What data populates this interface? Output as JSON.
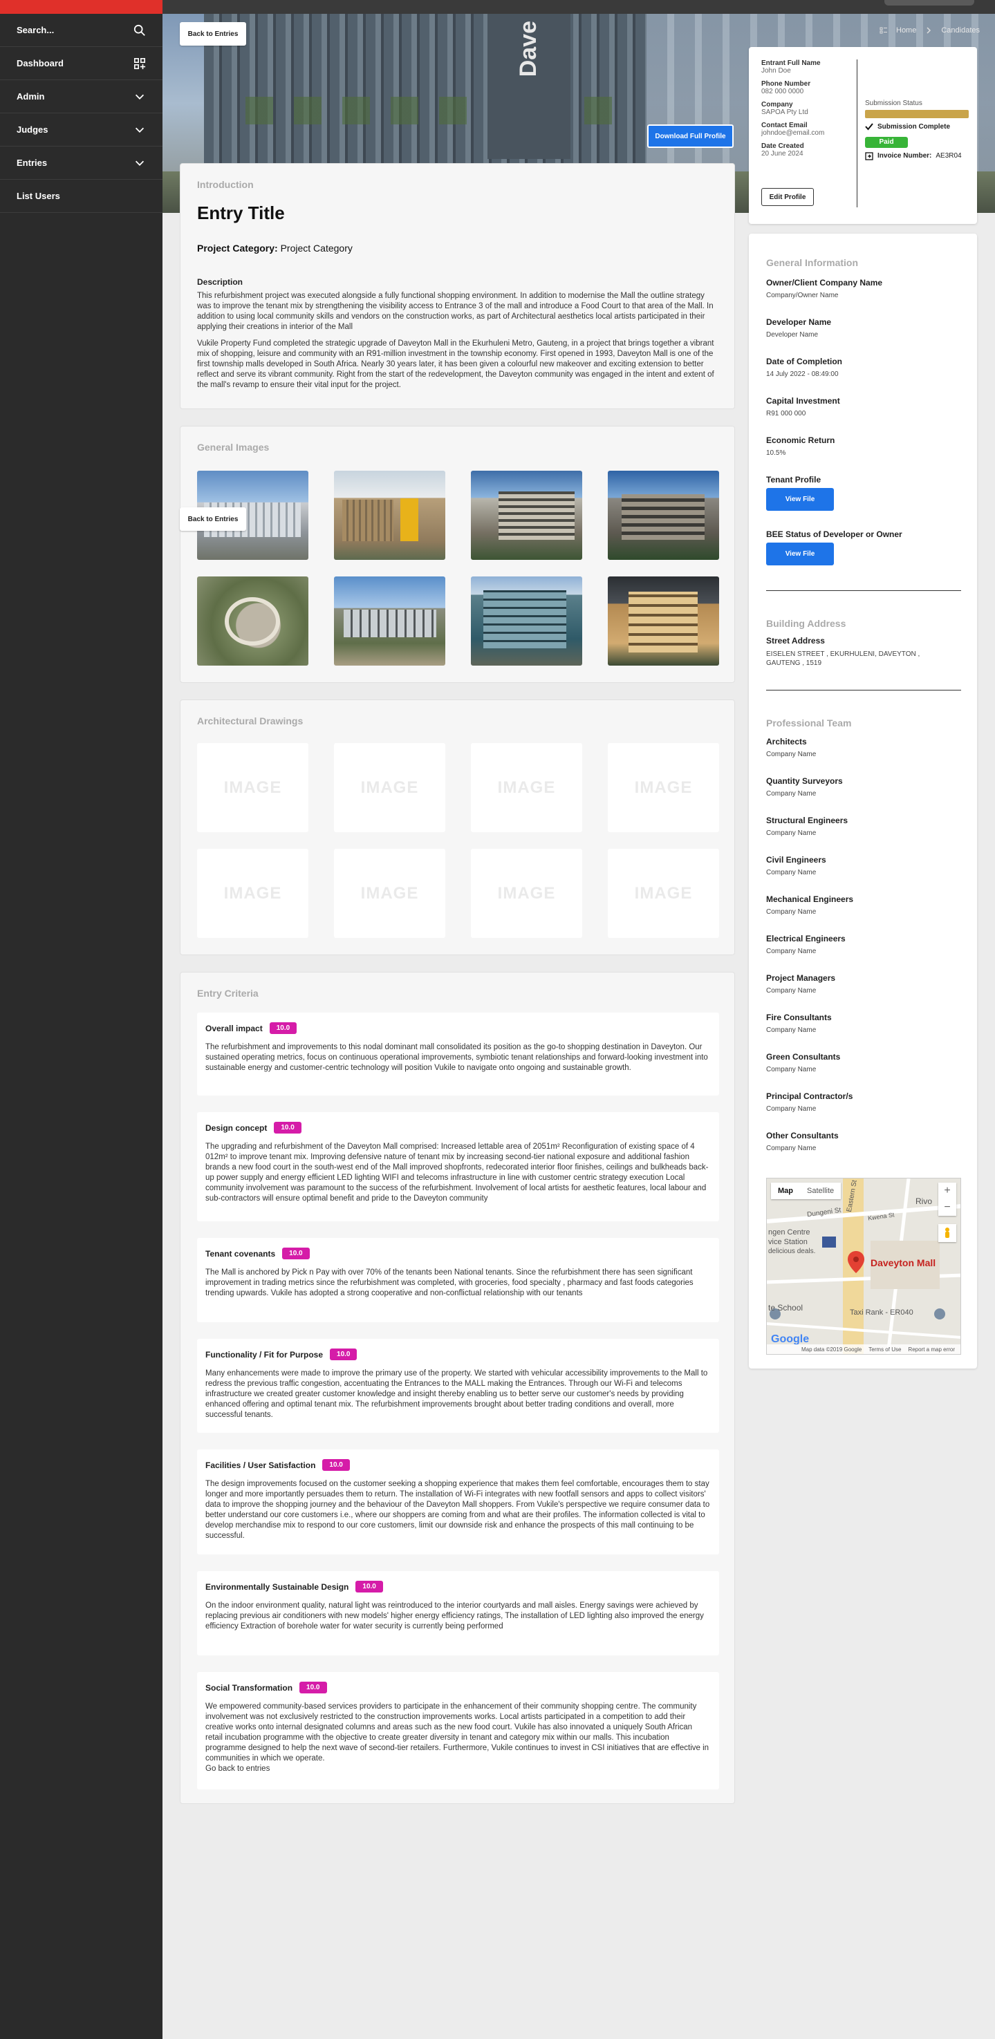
{
  "sidebar": {
    "search_label": "Search...",
    "items": [
      {
        "label": "Dashboard"
      },
      {
        "label": "Admin"
      },
      {
        "label": "Judges"
      },
      {
        "label": "Entries"
      },
      {
        "label": "List Users"
      }
    ]
  },
  "breadcrumb": {
    "home": "Home",
    "current": "Candidates"
  },
  "hero": {
    "sign_text": "Dave"
  },
  "buttons": {
    "back_to_entries": "Back to Entries",
    "download_profile": "Download Full Profile",
    "edit_profile": "Edit Profile",
    "view_file": "View File"
  },
  "profile": {
    "entrant_label": "Entrant Full Name",
    "entrant_value": "John Doe",
    "phone_label": "Phone Number",
    "phone_value": "082 000 0000",
    "company_label": "Company",
    "company_value": "SAPOA Pty Ltd",
    "email_label": "Contact Email",
    "email_value": "johndoe@email.com",
    "date_label": "Date Created",
    "date_value": "20 June 2024",
    "status_label": "Submission Status",
    "status_progress": 1.0,
    "status_complete": "Submission Complete",
    "paid": "Paid",
    "invoice_label": "Invoice Number:",
    "invoice_value": "AE3R04"
  },
  "intro": {
    "section": "Introduction",
    "title": "Entry Title",
    "category_label": "Project Category:",
    "category_value": "Project Category",
    "description_label": "Description",
    "paragraph1": "This refurbishment project was executed alongside a fully functional shopping environment. In addition to modernise the Mall the outline strategy was to improve the tenant mix by strengthening the visibility access to Entrance 3 of the mall and introduce a Food Court to that area of the Mall. In addition to using local community skills and vendors on the construction works, as part of Architectural aesthetics local artists participated in their applying their creations in interior of the Mall",
    "paragraph2": "Vukile Property Fund completed the strategic upgrade of Daveyton Mall in the Ekurhuleni Metro, Gauteng, in a project that brings together a vibrant mix of shopping, leisure and community with an R91-million investment in the township economy. First opened in 1993, Daveyton Mall is one of the first township malls developed in South Africa. Nearly 30 years later, it has been given a colourful new makeover and exciting extension to better reflect and serve its vibrant community. Right from the start of the redevelopment, the Daveyton community was engaged in the intent and extent of the mall's revamp to ensure their vital input for the project."
  },
  "general_images": {
    "section": "General Images"
  },
  "drawings": {
    "section": "Architectural Drawings",
    "placeholder": "IMAGE"
  },
  "criteria": {
    "section": "Entry Criteria",
    "items": [
      {
        "name": "Overall impact",
        "score": "10.0",
        "text": "The refurbishment and improvements to this nodal dominant mall consolidated its position as the go-to shopping destination in Daveyton. Our sustained operating metrics, focus on continuous operational improvements, symbiotic tenant relationships and forward-looking investment into sustainable energy and customer-centric technology will position Vukile to navigate onto ongoing and sustainable growth."
      },
      {
        "name": "Design concept",
        "score": "10.0",
        "text": "The upgrading and refurbishment of the Daveyton Mall comprised:      Increased lettable area of 2051m²      Reconfiguration of existing space of 4 012m² to improve tenant mix.      Improving defensive nature of tenant mix by increasing second-tier national exposure and additional fashion brands      a new food court in the south-west end of the Mall      improved shopfronts, redecorated interior floor finishes, ceilings and bulkheads      back-up power supply and energy efficient LED lighting      WIFI and telecoms infrastructure in line with customer centric strategy execution Local community involvement was paramount to the success of the refurbishment. Involvement of local artists for aesthetic features, local labour and sub-contractors will ensure optimal benefit and pride to the Daveyton community"
      },
      {
        "name": "Tenant covenants",
        "score": "10.0",
        "text": "The Mall is anchored by Pick n Pay with over 70% of the tenants been National tenants. Since the refurbishment there has seen significant improvement in trading metrics since the refurbishment was completed, with groceries, food specialty , pharmacy and fast foods categories trending upwards. Vukile has adopted a strong cooperative and non-conflictual relationship with our tenants"
      },
      {
        "name": "Functionality / Fit for Purpose",
        "score": "10.0",
        "text": "Many enhancements were made to improve the primary use of the property. We started with vehicular accessibility improvements to the Mall to redress the previous traffic congestion, accentuating the Entrances to the MALL making the Entrances. Through our Wi-Fi and telecoms infrastructure we created greater customer knowledge and insight thereby enabling us to better serve our customer's needs by providing enhanced offering and optimal tenant mix. The refurbishment improvements brought about better trading conditions and overall, more successful tenants."
      },
      {
        "name": "Facilities / User Satisfaction",
        "score": "10.0",
        "text": "The design improvements focused on the customer seeking a shopping experience that makes them feel comfortable, encourages them to stay longer and more importantly persuades them to return. The installation of Wi-Fi integrates with new footfall sensors and apps to collect visitors' data to improve the shopping journey and the behaviour of the Daveyton Mall shoppers. From Vukile's perspective we require consumer data to better understand our core customers i.e., where our shoppers are coming from and what are their profiles. The information collected is vital to develop merchandise mix to respond to our core customers, limit our downside risk and enhance the prospects of this mall continuing to be successful."
      },
      {
        "name": "Environmentally Sustainable Design",
        "score": "10.0",
        "text": "On the indoor environment quality, natural light was reintroduced to the interior courtyards and mall aisles. Energy savings were achieved by replacing previous air conditioners with new models' higher energy efficiency ratings, The installation of LED lighting also improved the energy efficiency Extraction of borehole water for water security is currently being performed"
      },
      {
        "name": "Social Transformation",
        "score": "10.0",
        "text": "We empowered community-based services providers to participate in the enhancement of their community shopping centre. The community involvement was not exclusively restricted to the construction improvements works. Local artists participated in a competition to add their creative works onto internal designated columns and areas such as the new food court. Vukile has also innovated a uniquely South African retail incubation programme with the objective to create greater diversity in tenant and category mix within our malls. This incubation programme designed to help the next wave of second-tier retailers. Furthermore, Vukile continues to invest in CSI initiatives that are effective in communities in which we operate.",
        "link": "Go back to entries"
      }
    ]
  },
  "general_info": {
    "section": "General Information",
    "owner_label": "Owner/Client Company Name",
    "owner_value": "Company/Owner Name",
    "developer_label": "Developer Name",
    "developer_value": "Developer Name",
    "completion_label": "Date of Completion",
    "completion_value": "14 July 2022 - 08:49:00",
    "investment_label": "Capital Investment",
    "investment_value": "R91 000 000",
    "return_label": "Economic Return",
    "return_value": "10.5%",
    "tenant_label": "Tenant Profile",
    "bee_label": "BEE Status of Developer or Owner"
  },
  "address": {
    "section": "Building Address",
    "street_label": "Street Address",
    "street_value": "EISELEN STREET , EKURHULENI, DAVEYTON , GAUTENG , 1519"
  },
  "team": {
    "section": "Professional Team",
    "members": [
      {
        "role": "Architects",
        "company": "Company Name"
      },
      {
        "role": "Quantity Surveyors",
        "company": "Company Name"
      },
      {
        "role": "Structural Engineers",
        "company": "Company Name"
      },
      {
        "role": "Civil Engineers",
        "company": "Company Name"
      },
      {
        "role": "Mechanical Engineers",
        "company": "Company Name"
      },
      {
        "role": "Electrical Engineers",
        "company": "Company Name"
      },
      {
        "role": "Project Managers",
        "company": "Company Name"
      },
      {
        "role": "Fire Consultants",
        "company": "Company Name"
      },
      {
        "role": "Green Consultants",
        "company": "Company Name"
      },
      {
        "role": "Principal Contractor/s",
        "company": "Company Name"
      },
      {
        "role": "Other Consultants",
        "company": "Company Name"
      }
    ]
  },
  "map": {
    "tab_map": "Map",
    "tab_satellite": "Satellite",
    "place_name": "Daveyton Mall",
    "label_centre": "ngen Centre",
    "label_station": "vice Station",
    "label_deals": "delicious deals.",
    "label_street1": "Dungeni St",
    "label_street2": "Kwena St",
    "label_street3": "Eastern St",
    "label_river": "Rivo",
    "label_school": "te School",
    "label_taxi": "Taxi Rank - ER040",
    "google": "Google",
    "map_data": "Map data ©2019 Google",
    "terms": "Terms of Use",
    "report": "Report a map error"
  },
  "colors": {
    "sidebar_bg": "#2b2b2b",
    "brand_red": "#e0302a",
    "accent_blue": "#1e74e8",
    "score_magenta": "#d51ca8",
    "paid_green": "#38b438",
    "status_gold": "#c9a44a"
  }
}
